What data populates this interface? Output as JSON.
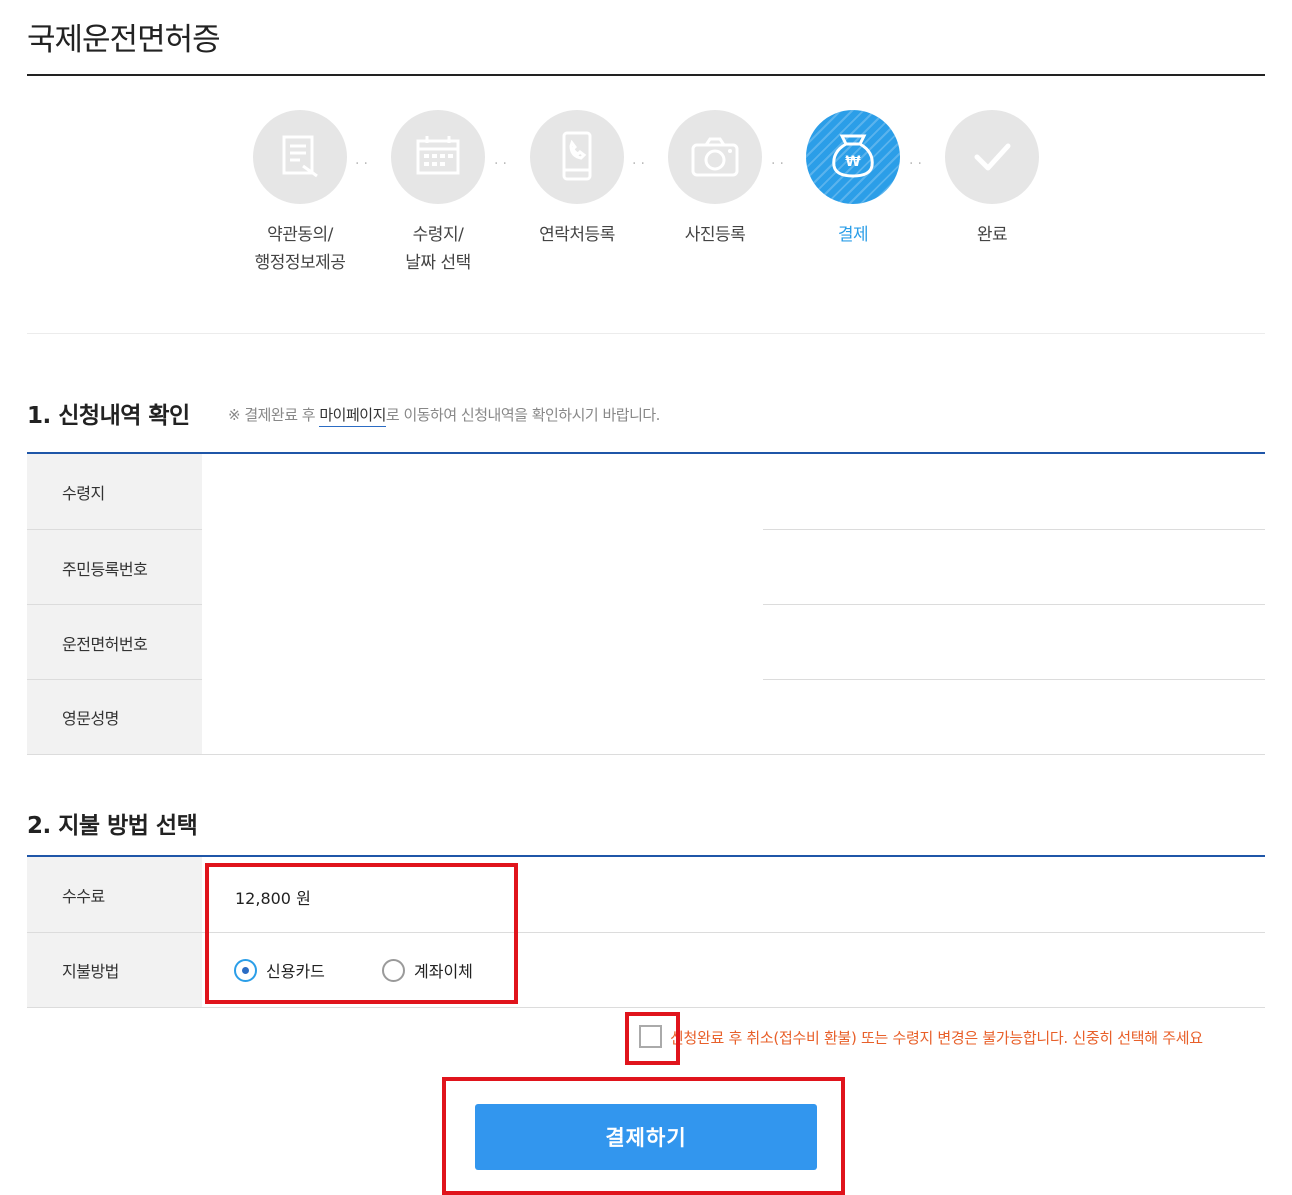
{
  "page": {
    "title": "국제운전면허증"
  },
  "steps": [
    {
      "label": "약관동의/\n행정정보제공",
      "icon": "document-icon",
      "active": false
    },
    {
      "label": "수령지/\n날짜 선택",
      "icon": "calendar-icon",
      "active": false
    },
    {
      "label": "연락처등록",
      "icon": "phone-icon",
      "active": false
    },
    {
      "label": "사진등록",
      "icon": "camera-icon",
      "active": false
    },
    {
      "label": "결제",
      "icon": "won-bag-icon",
      "active": true
    },
    {
      "label": "완료",
      "icon": "check-icon",
      "active": false
    }
  ],
  "section1": {
    "title": "1. 신청내역 확인",
    "note_prefix": "※ 결제완료 후 ",
    "note_link": "마이페이지",
    "note_suffix": "로 이동하여 신청내역을 확인하시기 바랍니다.",
    "rows": [
      {
        "label": "수령지",
        "value": ""
      },
      {
        "label": "주민등록번호",
        "value": ""
      },
      {
        "label": "운전면허번호",
        "value": ""
      },
      {
        "label": "영문성명",
        "value": ""
      }
    ]
  },
  "section2": {
    "title": "2. 지불 방법 선택",
    "fee_label": "수수료",
    "fee_value": "12,800 원",
    "method_label": "지불방법",
    "methods": [
      {
        "label": "신용카드",
        "checked": true
      },
      {
        "label": "계좌이체",
        "checked": false
      }
    ]
  },
  "agreement": {
    "checked": false,
    "text": "신청완료 후 취소(접수비 환불) 또는 수령지 변경은 불가능합니다. 신중히 선택해 주세요"
  },
  "pay_button": {
    "label": "결제하기"
  },
  "colors": {
    "accent": "#2b9ee8",
    "button": "#3296ee",
    "warning": "#e8602a",
    "highlight": "#e0141c",
    "table_rule": "#1f56a8"
  }
}
